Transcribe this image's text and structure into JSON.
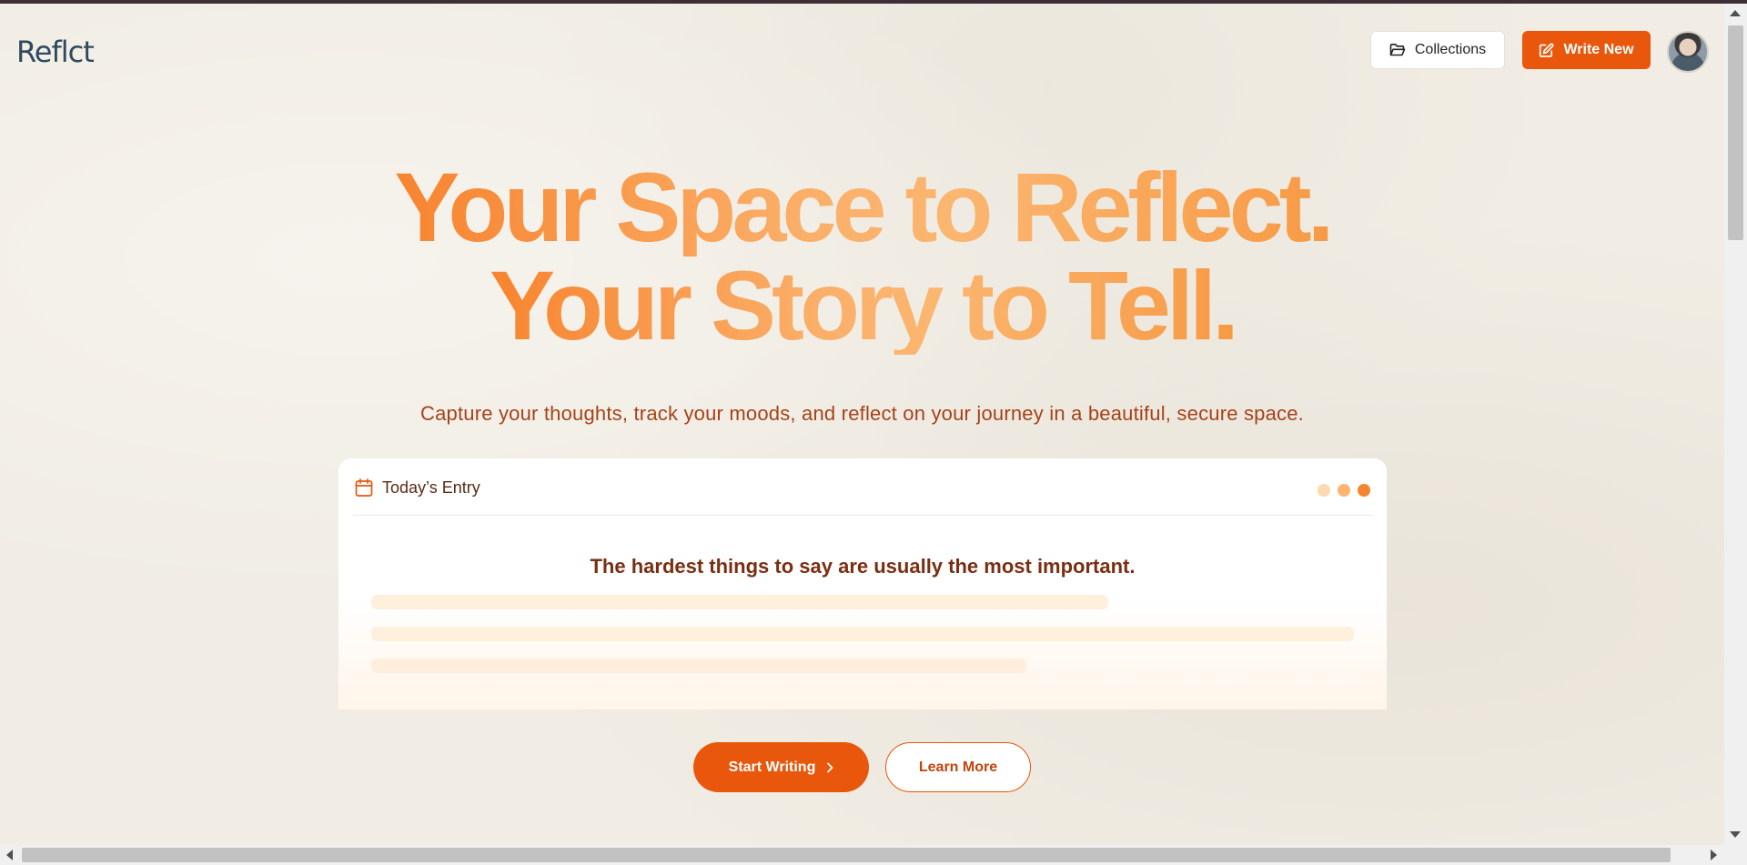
{
  "header": {
    "logo_text": "Reflct",
    "collections_label": "Collections",
    "write_new_label": "Write New"
  },
  "hero": {
    "title_line1": "Your Space to Reflect.",
    "title_line2": "Your Story to Tell.",
    "subtitle": "Capture your thoughts, track your moods, and reflect on your journey in a beautiful, secure space."
  },
  "entry_card": {
    "title": "Today’s Entry",
    "prompt": "The hardest things to say are usually the most important.",
    "dot_colors": [
      "#fcd9b0",
      "#fbb570",
      "#f7842f"
    ]
  },
  "actions": {
    "start_label": "Start Writing",
    "learn_label": "Learn More"
  },
  "icons": {
    "collections": "folder-open-icon",
    "write_new": "edit-icon",
    "entry": "calendar-icon",
    "start": "chevron-right-icon"
  },
  "colors": {
    "accent": "#e8570c",
    "title_gradient_start": "#f7842f",
    "title_gradient_mid": "#fbb06a",
    "subtitle": "#a6421a",
    "prompt": "#7a2e12"
  }
}
